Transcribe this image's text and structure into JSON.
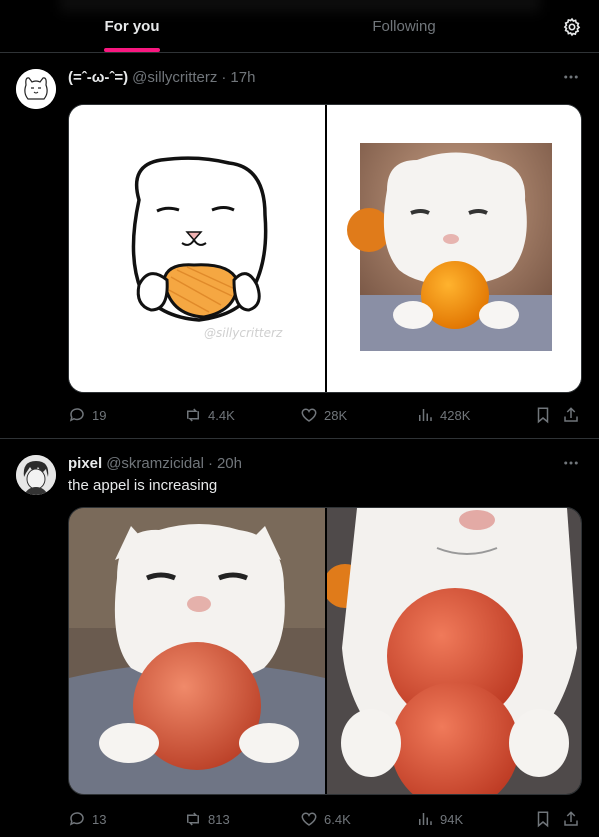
{
  "header": {
    "tabs": [
      {
        "label": "For you",
        "active": true
      },
      {
        "label": "Following",
        "active": false
      }
    ],
    "settings_icon": "gear-icon",
    "accent_color": "#f91880"
  },
  "tweets": [
    {
      "display_name": "(=ˆ-ω-ˆ=)",
      "handle": "@sillycritterz",
      "dot": "·",
      "time": "17h",
      "text": "",
      "media": {
        "left": "drawing of a white cat holding an orange",
        "right": "photo of a white cat holding an orange",
        "watermark": "@sillycritterz"
      },
      "stats": {
        "replies": "19",
        "reposts": "4.4K",
        "likes": "28K",
        "views": "428K"
      }
    },
    {
      "display_name": "pixel",
      "handle": "@skramzicidal",
      "dot": "·",
      "time": "20h",
      "text": "the appel is increasing",
      "media": {
        "left": "photo of a white cat holding one apple",
        "right": "photo of a white cat holding two stacked apples"
      },
      "stats": {
        "replies": "13",
        "reposts": "813",
        "likes": "6.4K",
        "views": "94K"
      }
    }
  ]
}
